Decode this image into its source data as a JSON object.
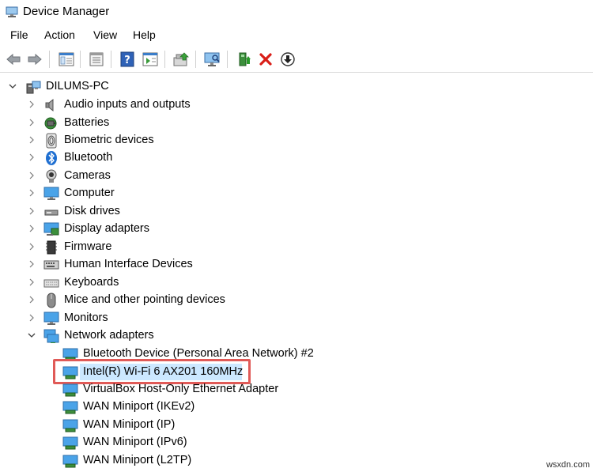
{
  "window": {
    "title": "Device Manager"
  },
  "menu": [
    "File",
    "Action",
    "View",
    "Help"
  ],
  "toolbar": {
    "buttons": [
      "back-icon",
      "forward-icon",
      "show-hide-console-tree-icon",
      "properties-icon",
      "help-icon",
      "action-pane-icon",
      "update-driver-icon",
      "scan-hardware-icon",
      "enable-device-icon",
      "uninstall-device-icon",
      "disable-device-icon"
    ]
  },
  "tree": {
    "root": "DILUMS-PC",
    "categories": [
      "Audio inputs and outputs",
      "Batteries",
      "Biometric devices",
      "Bluetooth",
      "Cameras",
      "Computer",
      "Disk drives",
      "Display adapters",
      "Firmware",
      "Human Interface Devices",
      "Keyboards",
      "Mice and other pointing devices",
      "Monitors",
      "Network adapters"
    ],
    "network_adapters": [
      "Bluetooth Device (Personal Area Network) #2",
      "Intel(R) Wi-Fi 6 AX201 160MHz",
      "VirtualBox Host-Only Ethernet Adapter",
      "WAN Miniport (IKEv2)",
      "WAN Miniport (IP)",
      "WAN Miniport (IPv6)",
      "WAN Miniport (L2TP)"
    ],
    "selected": "Intel(R) Wi-Fi 6 AX201 160MHz"
  },
  "watermark": "wsxdn.com",
  "colors": {
    "highlight": "#e05a57",
    "selection": "#cce8ff",
    "accent": "#0078d7"
  }
}
